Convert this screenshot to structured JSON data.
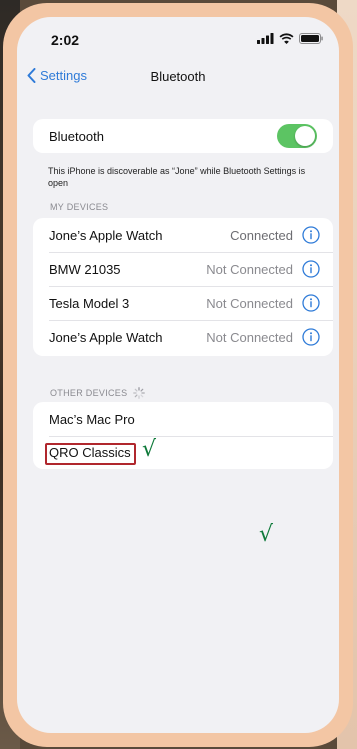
{
  "status_bar": {
    "time": "2:02",
    "icons": [
      "signal-icon",
      "wifi-icon",
      "battery-icon"
    ]
  },
  "nav": {
    "back_label": "Settings",
    "title": "Bluetooth"
  },
  "bluetooth": {
    "label": "Bluetooth",
    "enabled": true
  },
  "discover_note": "This iPhone is discoverable as “Jone” while Bluetooth Settings is open",
  "my_devices": {
    "header": "MY DEVICES",
    "items": [
      {
        "name": "Jone’s Apple Watch",
        "status": "Connected"
      },
      {
        "name": "BMW 21035",
        "status": "Not Connected"
      },
      {
        "name": "Tesla Model 3",
        "status": "Not Connected"
      },
      {
        "name": "Jone’s Apple Watch",
        "status": "Not Connected"
      }
    ]
  },
  "other_devices": {
    "header": "OTHER DEVICES",
    "items": [
      {
        "name": "Mac’s Mac Pro"
      },
      {
        "name": "QRO Classics"
      }
    ]
  },
  "annotations": {
    "checkmark_1": "√",
    "checkmark_2": "√"
  },
  "colors": {
    "accent": "#2f7bd8",
    "toggle_on": "#5cc463",
    "highlight": "#b0272d",
    "check": "#0f7a3a"
  }
}
